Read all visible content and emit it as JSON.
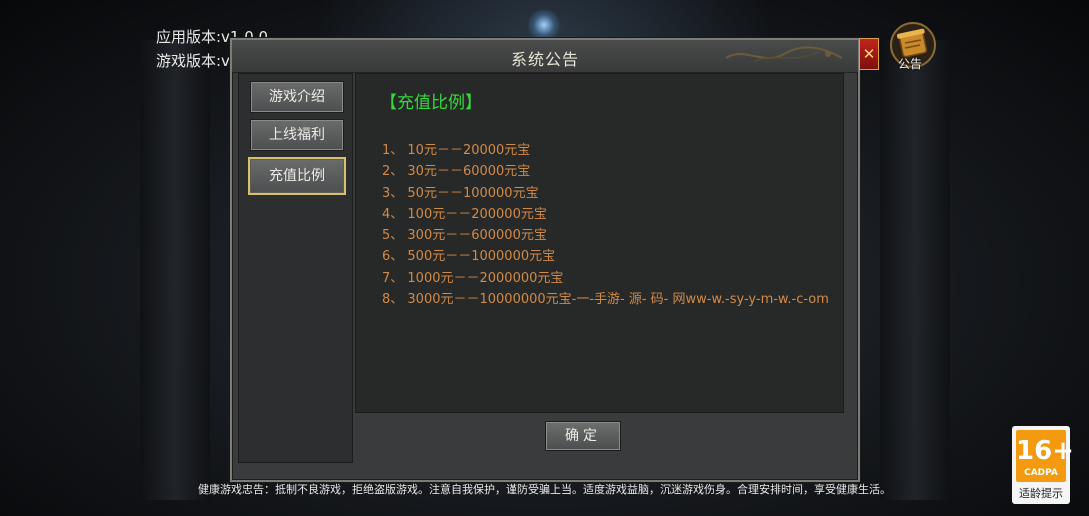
{
  "header": {
    "app_version": "应用版本:v1.0.0",
    "game_version": "游戏版本:v"
  },
  "dialog": {
    "title": "系统公告",
    "close_label": "✕",
    "tabs": [
      {
        "label": "游戏介绍",
        "selected": false
      },
      {
        "label": "上线福利",
        "selected": false
      },
      {
        "label": "充值比例",
        "selected": true
      }
    ],
    "content_title": "【充值比例】",
    "rates": [
      "1、 10元－－20000元宝",
      "2、 30元－－60000元宝",
      "3、 50元－－100000元宝",
      "4、 100元－－200000元宝",
      "5、 300元－－600000元宝",
      "6、 500元－－1000000元宝",
      "7、 1000元－－2000000元宝",
      "8、 3000元－－10000000元宝-一-手游- 源- 码- 网ww-w.-sy-y-m-w.-c-om"
    ],
    "confirm_label": "确定"
  },
  "notice_button": {
    "label": "公告",
    "icon": "scroll-icon"
  },
  "footer": {
    "text": "健康游戏忠告：抵制不良游戏，拒绝盗版游戏。注意自我保护，谨防受骗上当。适度游戏益脑，沉迷游戏伤身。合理安排时间，享受健康生活。"
  },
  "age_rating": {
    "number": "16+",
    "org": "CADPA",
    "tip": "适龄提示"
  },
  "colors": {
    "green_title": "#33d93a",
    "rate_text": "#d28a47",
    "badge_orange": "#f39a10"
  }
}
